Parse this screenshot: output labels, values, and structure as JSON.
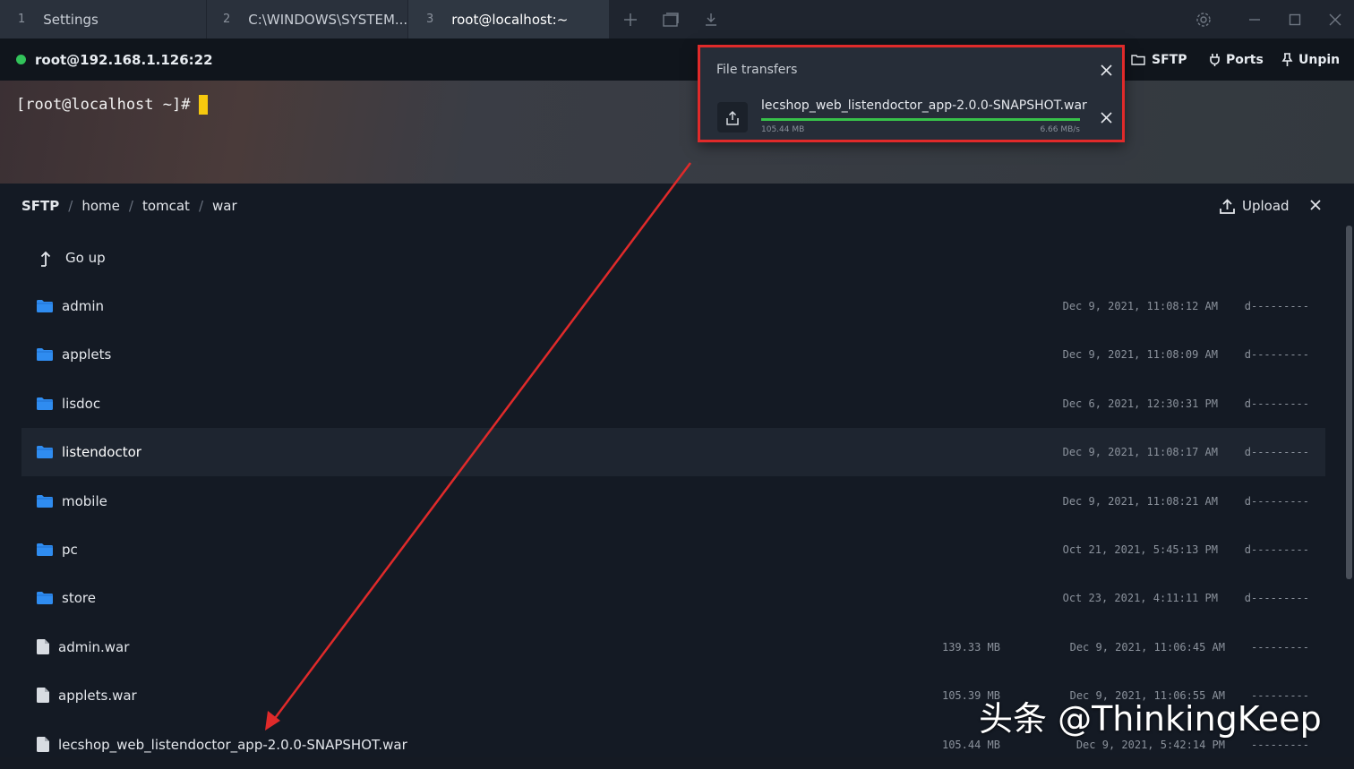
{
  "tabs": [
    {
      "num": "1",
      "label": "Settings"
    },
    {
      "num": "2",
      "label": "C:\\WINDOWS\\SYSTEM..."
    },
    {
      "num": "3",
      "label": "root@localhost:~"
    }
  ],
  "connection": {
    "host": "root@192.168.1.126:22",
    "status_color": "#32c35a"
  },
  "toolbar": {
    "sftp": "SFTP",
    "ports": "Ports",
    "unpin": "Unpin"
  },
  "terminal": {
    "prompt": "[root@localhost ~]#",
    "cursor_color": "#f6c90e"
  },
  "transfers": {
    "title": "File transfers",
    "file": "lecshop_web_listendoctor_app-2.0.0-SNAPSHOT.war",
    "size": "105.44 MB",
    "speed": "6.66 MB/s",
    "progress": 1.0
  },
  "sftp": {
    "breadcrumb": [
      "SFTP",
      "home",
      "tomcat",
      "war"
    ],
    "upload_label": "Upload",
    "go_up_label": "Go up",
    "entries": [
      {
        "type": "folder",
        "name": "admin",
        "size": "",
        "date": "Dec 9, 2021, 11:08:12 AM",
        "perm": "d---------"
      },
      {
        "type": "folder",
        "name": "applets",
        "size": "",
        "date": "Dec 9, 2021, 11:08:09 AM",
        "perm": "d---------"
      },
      {
        "type": "folder",
        "name": "lisdoc",
        "size": "",
        "date": "Dec 6, 2021, 12:30:31 PM",
        "perm": "d---------"
      },
      {
        "type": "folder",
        "name": "listendoctor",
        "size": "",
        "date": "Dec 9, 2021, 11:08:17 AM",
        "perm": "d---------",
        "selected": true
      },
      {
        "type": "folder",
        "name": "mobile",
        "size": "",
        "date": "Dec 9, 2021, 11:08:21 AM",
        "perm": "d---------"
      },
      {
        "type": "folder",
        "name": "pc",
        "size": "",
        "date": "Oct 21, 2021, 5:45:13 PM",
        "perm": "d---------"
      },
      {
        "type": "folder",
        "name": "store",
        "size": "",
        "date": "Oct 23, 2021, 4:11:11 PM",
        "perm": "d---------"
      },
      {
        "type": "file",
        "name": "admin.war",
        "size": "139.33 MB",
        "date": "Dec 9, 2021, 11:06:45 AM",
        "perm": "---------"
      },
      {
        "type": "file",
        "name": "applets.war",
        "size": "105.39 MB",
        "date": "Dec 9, 2021, 11:06:55 AM",
        "perm": "---------"
      },
      {
        "type": "file",
        "name": "lecshop_web_listendoctor_app-2.0.0-SNAPSHOT.war",
        "size": "105.44 MB",
        "date": "Dec 9, 2021, 5:42:14 PM",
        "perm": "---------"
      }
    ]
  },
  "watermark": "头条 @ThinkingKeep",
  "colors": {
    "accent_folder": "#2f8cf0",
    "annotation": "#e02a2a",
    "progress": "#37c24a"
  }
}
